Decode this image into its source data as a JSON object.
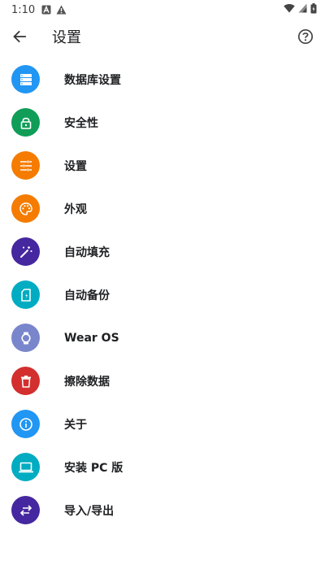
{
  "status_bar": {
    "time": "1:10",
    "icons": [
      "a-notification-icon",
      "warning-icon",
      "wifi-icon",
      "signal-icon",
      "battery-icon"
    ]
  },
  "app_bar": {
    "title": "设置",
    "back_icon": "arrow-back-icon",
    "help_icon": "help-circle-icon"
  },
  "menu": {
    "items": [
      {
        "label": "数据库设置",
        "icon": "database-icon",
        "color": "#2196F3"
      },
      {
        "label": "安全性",
        "icon": "lock-icon",
        "color": "#0F9D58"
      },
      {
        "label": "设置",
        "icon": "tune-icon",
        "color": "#F57C00"
      },
      {
        "label": "外观",
        "icon": "palette-icon",
        "color": "#F57C00"
      },
      {
        "label": "自动填充",
        "icon": "magic-wand-icon",
        "color": "#4527A0"
      },
      {
        "label": "自动备份",
        "icon": "sd-card-icon",
        "color": "#00ACC1"
      },
      {
        "label": "Wear OS",
        "icon": "watch-icon",
        "color": "#7986CB"
      },
      {
        "label": "擦除数据",
        "icon": "trash-icon",
        "color": "#D32F2F"
      },
      {
        "label": "关于",
        "icon": "info-icon",
        "color": "#2196F3"
      },
      {
        "label": "安装 PC 版",
        "icon": "laptop-icon",
        "color": "#00ACC1"
      },
      {
        "label": "导入/导出",
        "icon": "swap-icon",
        "color": "#4527A0"
      }
    ]
  }
}
